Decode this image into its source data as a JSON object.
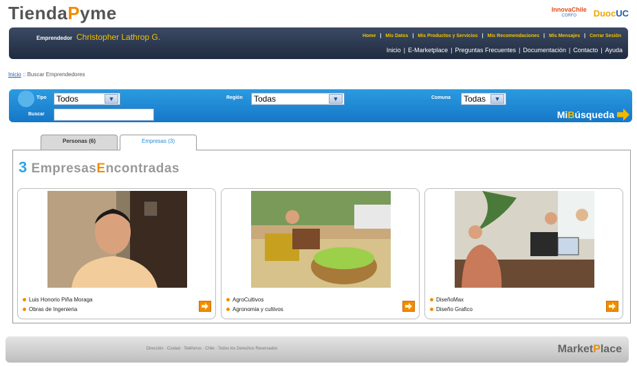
{
  "header": {
    "logo_part1": "Tienda",
    "logo_accent": "P",
    "logo_part2": "yme",
    "innova_label": "InnovaChile",
    "innova_sub": "CORFO",
    "duoc_part1": "Duoc",
    "duoc_part2": "UC"
  },
  "topbar": {
    "user_label": "Emprendedor",
    "user_name": "Christopher Lathrop G.",
    "nav_primary": [
      "Home",
      "Mis Datos",
      "Mis Productos y Servicios",
      "Mis Recomendaciones",
      "Mis Mensajes",
      "Cerrar Sesión"
    ],
    "nav_secondary": [
      "Inicio",
      "E-Marketplace",
      "Preguntas Frecuentes",
      "Documentación",
      "Contacto",
      "Ayuda"
    ]
  },
  "breadcrumb": {
    "home": "Inicio",
    "separator": " :: ",
    "current": "Buscar Emprendedores"
  },
  "search": {
    "tipo_label": "Tipo",
    "tipo_value": "Todos",
    "region_label": "Región",
    "region_value": "Todas",
    "comuna_label": "Comuna",
    "comuna_value": "Todas",
    "buscar_label": "Buscar",
    "buscar_value": "",
    "button_part1": "Mi",
    "button_accent": "B",
    "button_part2": "úsqueda"
  },
  "tabs": [
    {
      "label": "Personas (6)"
    },
    {
      "label": "Empresas (3)"
    }
  ],
  "results": {
    "count": "3",
    "word1_rest": "Empresas",
    "word2_accent": "E",
    "word2_rest": "ncontradas",
    "cards": [
      {
        "name": "Luis Honorio Piña Moraga",
        "category": "Obras de Ingenieria"
      },
      {
        "name": "AgroCultivos",
        "category": "Agronomia y cultivos"
      },
      {
        "name": "DiseñoMax",
        "category": "Diseño Grafico"
      }
    ]
  },
  "footer": {
    "text": "Dirección · Ciudad · Teléfonos · Chile · Todos los Derechos Reservados",
    "brand_part1": "Market",
    "brand_accent": "P",
    "brand_part2": "lace"
  },
  "colors": {
    "accent_orange": "#f28c00",
    "accent_yellow": "#f2c200",
    "topbar_navy": "#1f2b40",
    "search_blue": "#1577c8"
  }
}
